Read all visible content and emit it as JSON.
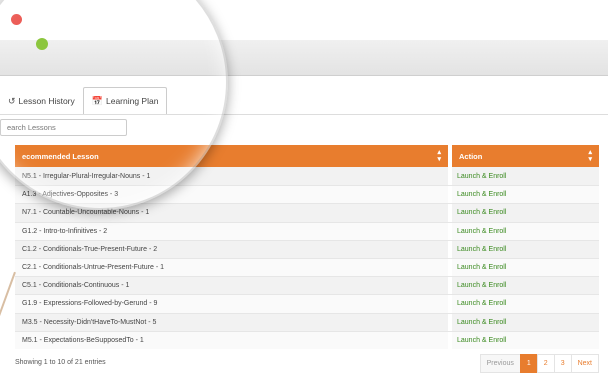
{
  "tabs": [
    {
      "label": "Lesson History",
      "icon": "history-icon"
    },
    {
      "label": "Learning Plan",
      "icon": "calendar-icon"
    }
  ],
  "search": {
    "placeholder": "earch Lessons"
  },
  "table": {
    "headers": [
      "ecommended Lesson",
      "Action"
    ],
    "rows": [
      {
        "lesson": "N5.1 - Irregular-Plural-Irregular-Nouns - 1",
        "action": "Launch & Enroll"
      },
      {
        "lesson": "A1.3 - Adjectives-Opposites - 3",
        "action": "Launch & Enroll"
      },
      {
        "lesson": "N7.1 - Countable-Uncountable-Nouns - 1",
        "action": "Launch & Enroll"
      },
      {
        "lesson": "G1.2 - Intro-to-Infinitives - 2",
        "action": "Launch & Enroll"
      },
      {
        "lesson": "C1.2 - Conditionals-True-Present-Future - 2",
        "action": "Launch & Enroll"
      },
      {
        "lesson": "C2.1 - Conditionals-Untrue-Present-Future - 1",
        "action": "Launch & Enroll"
      },
      {
        "lesson": "C5.1 - Conditionals-Continuous - 1",
        "action": "Launch & Enroll"
      },
      {
        "lesson": "G1.9 - Expressions-Followed-by-Gerund - 9",
        "action": "Launch & Enroll"
      },
      {
        "lesson": "M3.5 - Necessity-Didn'tHaveTo-MustNot - 5",
        "action": "Launch & Enroll"
      },
      {
        "lesson": "M5.1 - Expectations-BeSupposedTo - 1",
        "action": "Launch & Enroll"
      }
    ]
  },
  "footer": {
    "info": "Showing 1 to 10 of 21 entries"
  },
  "pagination": {
    "prev": "Previous",
    "pages": [
      "1",
      "2",
      "3"
    ],
    "next": "Next",
    "current": "1"
  },
  "colors": {
    "accent": "#e87d2e",
    "link": "#3a8a1f"
  }
}
